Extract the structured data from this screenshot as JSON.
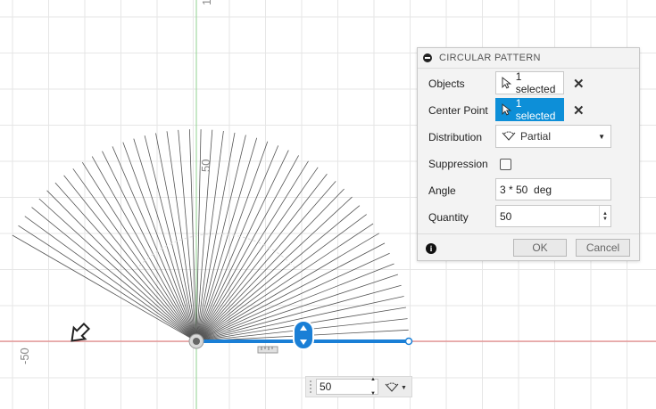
{
  "canvas": {
    "axis_labels": {
      "vertical_top": "1",
      "vertical_mid": "50",
      "horizontal_left": "-50"
    },
    "colors": {
      "x_axis": "#e06c6c",
      "y_axis": "#8fd18f",
      "grid": "#e6e6e6",
      "selection": "#1a7fd6",
      "lines": "#555555"
    }
  },
  "dialog": {
    "title": "CIRCULAR PATTERN",
    "objects": {
      "label": "Objects",
      "value": "1 selected"
    },
    "center_point": {
      "label": "Center Point",
      "value": "1 selected"
    },
    "distribution": {
      "label": "Distribution",
      "value": "Partial"
    },
    "suppression": {
      "label": "Suppression",
      "checked": false
    },
    "angle": {
      "label": "Angle",
      "value": "3 * 50  deg"
    },
    "quantity": {
      "label": "Quantity",
      "value": "50"
    },
    "ok_label": "OK",
    "cancel_label": "Cancel"
  },
  "quantity_widget": {
    "value": "50"
  },
  "pattern": {
    "count": 50,
    "total_angle_deg": 150
  }
}
